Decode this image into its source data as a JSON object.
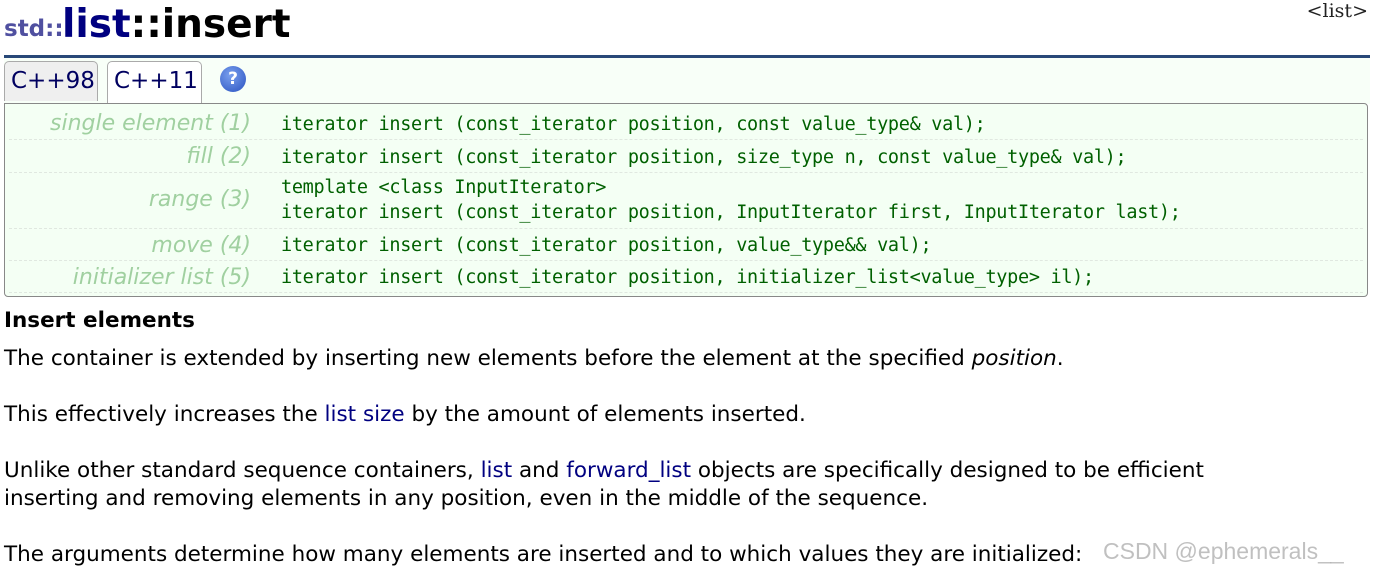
{
  "header": {
    "namespace": "std::",
    "class_name": "list",
    "member": "::insert",
    "header_link": "<list>"
  },
  "tabs": [
    {
      "label": "C++98"
    },
    {
      "label": "C++11"
    }
  ],
  "help_icon": "?",
  "signatures": [
    {
      "label": "single element (1)",
      "lines": [
        "iterator insert (const_iterator position, const value_type& val);"
      ]
    },
    {
      "label": "fill (2)",
      "lines": [
        "iterator insert (const_iterator position, size_type n, const value_type& val);"
      ]
    },
    {
      "label": "range (3)",
      "lines": [
        "template <class InputIterator>",
        "iterator insert (const_iterator position, InputIterator first, InputIterator last);"
      ]
    },
    {
      "label": "move (4)",
      "lines": [
        "iterator insert (const_iterator position, value_type&& val);"
      ]
    },
    {
      "label": "initializer list (5)",
      "lines": [
        "iterator insert (const_iterator position, initializer_list<value_type> il);"
      ]
    }
  ],
  "description": {
    "heading": "Insert elements",
    "p1_a": "The container is extended by inserting new elements before the element at the specified ",
    "p1_em": "position",
    "p1_b": ".",
    "p2_a": "This effectively increases the ",
    "p2_link": "list size",
    "p2_b": " by the amount of elements inserted.",
    "p3_a": "Unlike other standard sequence containers, ",
    "p3_link1": "list",
    "p3_mid": " and ",
    "p3_link2": "forward_list",
    "p3_b": " objects are specifically designed to be efficient",
    "p3_line2": "inserting and removing elements in any position, even in the middle of the sequence.",
    "p4": "The arguments determine how many elements are inserted and to which values they are initialized:"
  },
  "watermark": "CSDN @ephemerals__"
}
